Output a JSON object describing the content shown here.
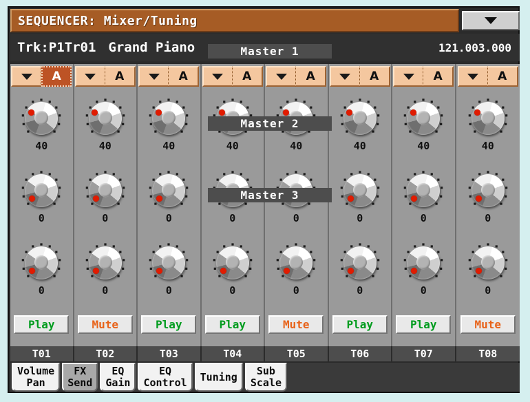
{
  "titlebar": {
    "title": "SEQUENCER: Mixer/Tuning",
    "menu_icon": "triangle-down-icon",
    "colors": {
      "bar": "#a65c25",
      "text": "#ffffff"
    }
  },
  "trackinfo": {
    "track": "Trk:P1Tr01",
    "sound": "Grand Piano",
    "position": "121.003.000"
  },
  "master_labels": [
    {
      "id": "m1",
      "label": "Master 1"
    },
    {
      "id": "m2",
      "label": "Master 2"
    },
    {
      "id": "m3",
      "label": "Master 3"
    }
  ],
  "channels": [
    {
      "id": "T01",
      "header_mode": "A",
      "selected": true,
      "row1": "40",
      "row2": "0",
      "row3": "0",
      "state": "Play"
    },
    {
      "id": "T02",
      "header_mode": "A",
      "selected": false,
      "row1": "40",
      "row2": "0",
      "row3": "0",
      "state": "Mute"
    },
    {
      "id": "T03",
      "header_mode": "A",
      "selected": false,
      "row1": "40",
      "row2": "0",
      "row3": "0",
      "state": "Play"
    },
    {
      "id": "T04",
      "header_mode": "A",
      "selected": false,
      "row1": "40",
      "row2": "0",
      "row3": "0",
      "state": "Play"
    },
    {
      "id": "T05",
      "header_mode": "A",
      "selected": false,
      "row1": "40",
      "row2": "0",
      "row3": "0",
      "state": "Mute"
    },
    {
      "id": "T06",
      "header_mode": "A",
      "selected": false,
      "row1": "40",
      "row2": "0",
      "row3": "0",
      "state": "Play"
    },
    {
      "id": "T07",
      "header_mode": "A",
      "selected": false,
      "row1": "40",
      "row2": "0",
      "row3": "0",
      "state": "Play"
    },
    {
      "id": "T08",
      "header_mode": "A",
      "selected": false,
      "row1": "40",
      "row2": "0",
      "row3": "0",
      "state": "Mute"
    }
  ],
  "tabs": [
    {
      "line1": "Volume",
      "line2": "Pan",
      "active": true
    },
    {
      "line1": "FX",
      "line2": "Send",
      "active": false
    },
    {
      "line1": "EQ",
      "line2": "Gain",
      "active": true
    },
    {
      "line1": "EQ",
      "line2": "Control",
      "active": true
    },
    {
      "line1": "Tuning",
      "line2": "",
      "active": true
    },
    {
      "line1": "Sub",
      "line2": "Scale",
      "active": true
    }
  ],
  "colors": {
    "screen_bg": "#d5efef",
    "panel_gray": "#9a9a9a",
    "dark_bar": "#4d4d4d",
    "play_green": "#009c1e",
    "mute_orange": "#e8631a",
    "knob_pointer": "#e01b00",
    "header_peach": "#f4c79f",
    "header_selected": "#bd5325"
  }
}
